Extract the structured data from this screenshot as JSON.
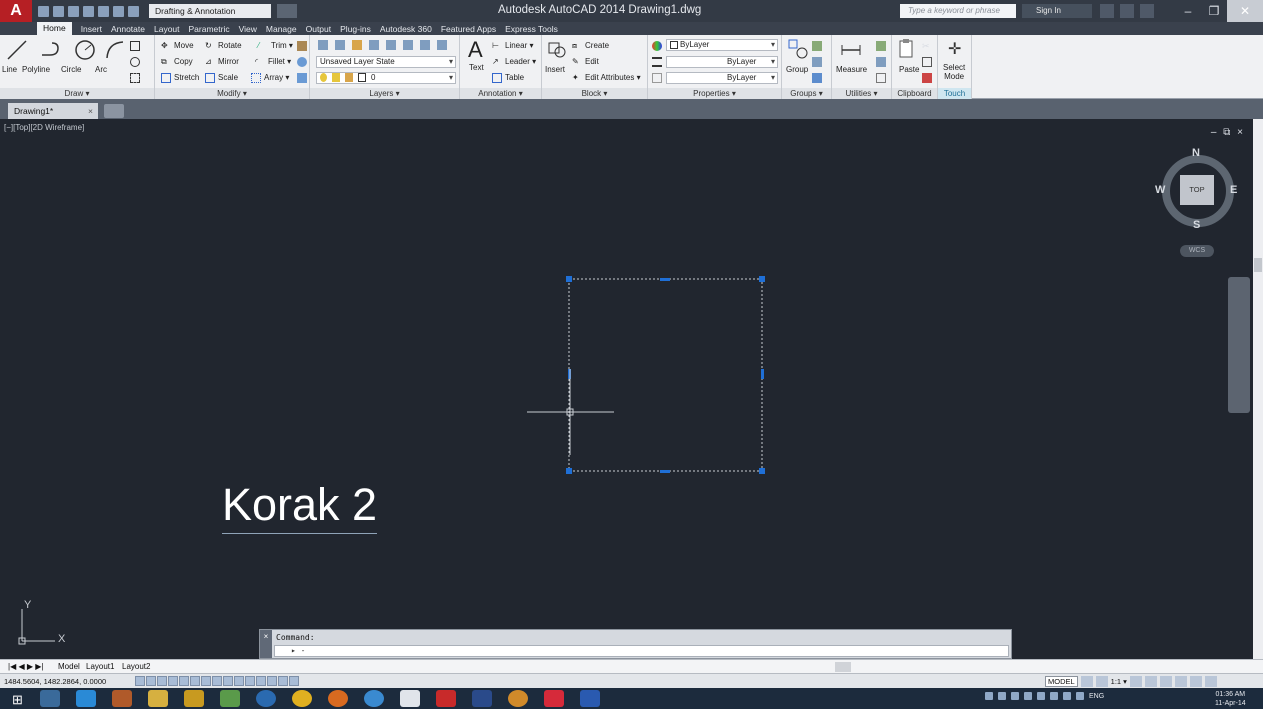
{
  "window": {
    "title": "Autodesk AutoCAD 2014   Drawing1.dwg",
    "workspace": "Drafting & Annotation",
    "search_placeholder": "Type a keyword or phrase",
    "sign_in": "Sign In",
    "app_letter": "A"
  },
  "ribbon_tabs": [
    "Home",
    "Insert",
    "Annotate",
    "Layout",
    "Parametric",
    "View",
    "Manage",
    "Output",
    "Plug-ins",
    "Autodesk 360",
    "Featured Apps",
    "Express Tools"
  ],
  "panels": {
    "draw": {
      "title": "Draw ▾",
      "line": "Line",
      "polyline": "Polyline",
      "circle": "Circle",
      "arc": "Arc"
    },
    "modify": {
      "title": "Modify ▾",
      "move": "Move",
      "rotate": "Rotate",
      "trim": "Trim",
      "copy": "Copy",
      "mirror": "Mirror",
      "fillet": "Fillet",
      "stretch": "Stretch",
      "scale": "Scale",
      "array": "Array"
    },
    "layers": {
      "title": "Layers ▾",
      "layer_state": "Unsaved Layer State",
      "current_layer": "0"
    },
    "annotation": {
      "title": "Annotation ▾",
      "text": "Text",
      "linear": "Linear",
      "leader": "Leader",
      "table": "Table"
    },
    "block": {
      "title": "Block ▾",
      "insert": "Insert",
      "create": "Create",
      "edit": "Edit",
      "edit_attributes": "Edit Attributes"
    },
    "properties": {
      "title": "Properties ▾",
      "color": "ByLayer",
      "lineweight": "ByLayer",
      "linetype": "ByLayer"
    },
    "groups": {
      "title": "Groups ▾",
      "group": "Group"
    },
    "utilities": {
      "title": "Utilities ▾",
      "measure": "Measure"
    },
    "clipboard": {
      "title": "Clipboard",
      "paste": "Paste"
    },
    "touch": {
      "title": "Touch",
      "select_mode_1": "Select",
      "select_mode_2": "Mode"
    }
  },
  "doc_tab": {
    "name": "Drawing1*",
    "close": "×"
  },
  "viewport": {
    "label": "[−][Top][2D Wireframe]",
    "controls": "– ⧉ ×",
    "viewcube": {
      "top": "TOP",
      "n": "N",
      "s": "S",
      "e": "E",
      "w": "W",
      "wcs": "WCS"
    },
    "text": "Korak 2",
    "ucs_x": "X",
    "ucs_y": "Y"
  },
  "command": {
    "history": "Command:",
    "prompt": "▸ -",
    "close": "×"
  },
  "layouts": {
    "nav": "|◀ ◀ ▶ ▶|",
    "model": "Model",
    "layout1": "Layout1",
    "layout2": "Layout2"
  },
  "status": {
    "coords": "1484.5604, 1482.2864, 0.0000",
    "model": "MODEL",
    "scale": "1:1 ▾"
  },
  "taskbar": {
    "lang": "ENG",
    "time": "01:36 AM",
    "date": "11-Apr-14"
  }
}
